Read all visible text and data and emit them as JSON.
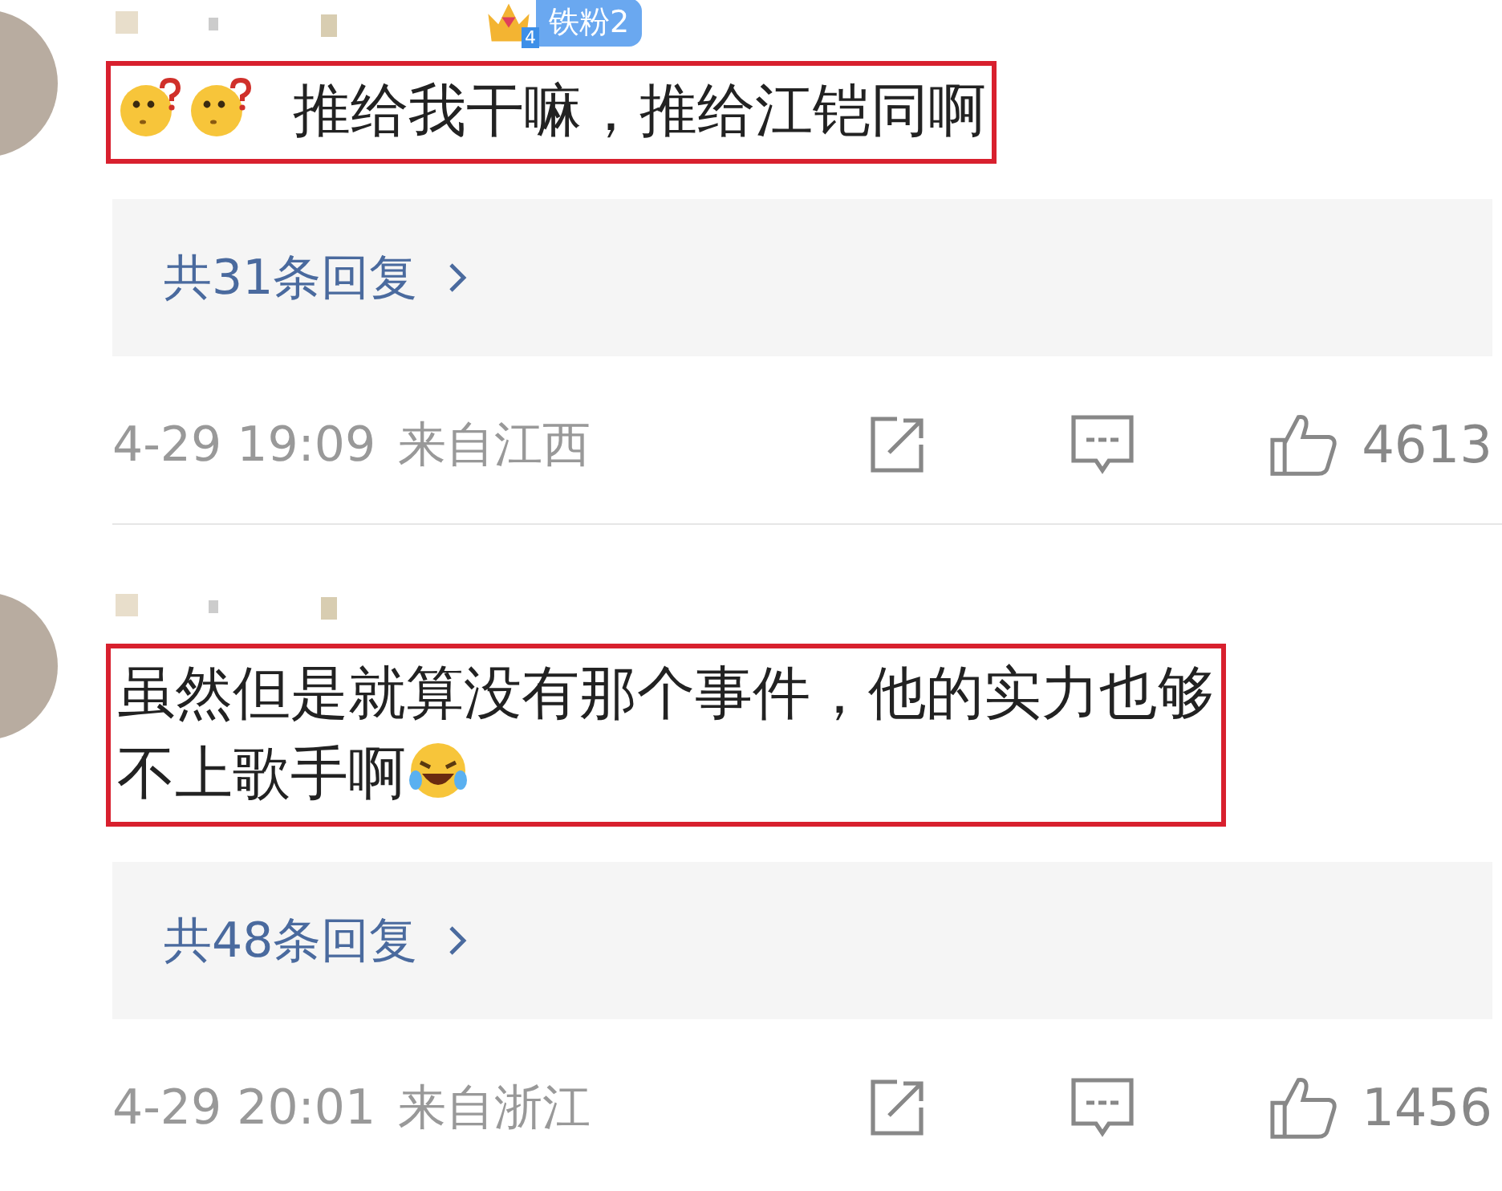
{
  "comments": [
    {
      "badge": {
        "level_text": "4",
        "label": "铁粉2"
      },
      "highlighted": true,
      "emojis_before": [
        {
          "kind": "puzzled"
        },
        {
          "kind": "puzzled"
        }
      ],
      "text_lines": [
        "推给我干嘛，推给江铠同啊"
      ],
      "replies": "共31条回复",
      "time": "4-29 19:09",
      "location": "来自江西",
      "likes": "4613"
    },
    {
      "highlighted": true,
      "text_lines": [
        "虽然但是就算没有那个事件，他的实力也够",
        "不上歌手啊"
      ],
      "emojis_after": [
        {
          "kind": "laughing"
        }
      ],
      "replies": "共48条回复",
      "time": "4-29 20:01",
      "location": "来自浙江",
      "likes": "1456"
    }
  ]
}
